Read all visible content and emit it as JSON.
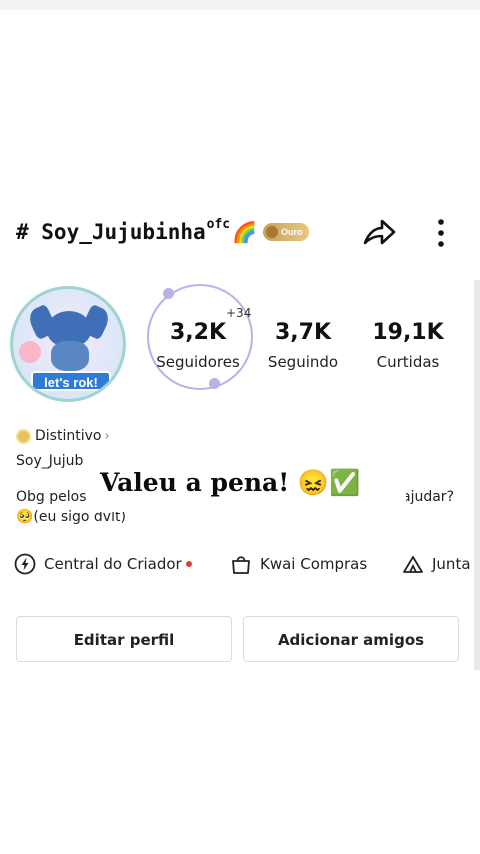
{
  "profile": {
    "username": "# Soy_Jujubinha",
    "username_suffix": "ofc",
    "rainbow_emoji": "🌈",
    "level_badge": "Ouro",
    "avatar_banner": "let's rok!",
    "new_followers_delta": "+34"
  },
  "stats": [
    {
      "value": "3,2K",
      "label": "Seguidores"
    },
    {
      "value": "3,7K",
      "label": "Seguindo"
    },
    {
      "value": "19,1K",
      "label": "Curtidas"
    }
  ],
  "bio": {
    "badge_label": "Distintivo",
    "name_line": "Soy_Jujub",
    "line1_start": "Obg pelos",
    "line1_end": "ajudar?",
    "line2": "🥺(eu sigo dvlt)"
  },
  "overlay": {
    "text": "Valeu a pena! 😖✅"
  },
  "links": [
    {
      "label": "Central do Criador",
      "icon": "lightning-icon"
    },
    {
      "label": "Kwai Compras",
      "icon": "shopping-bag-icon"
    },
    {
      "label": "Junta",
      "icon": "tent-icon"
    }
  ],
  "actions": {
    "edit_profile": "Editar perfil",
    "add_friends": "Adicionar amigos"
  },
  "colors": {
    "ring": "#b9b2e6",
    "badge_gold": "#c9a25b",
    "notification_red": "#e53935"
  }
}
